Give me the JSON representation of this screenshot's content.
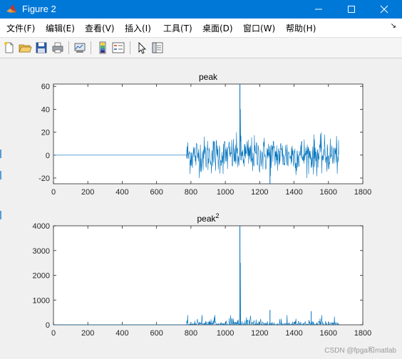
{
  "window": {
    "title": "Figure 2"
  },
  "menu": [
    {
      "label": "文件(F)"
    },
    {
      "label": "编辑(E)"
    },
    {
      "label": "查看(V)"
    },
    {
      "label": "插入(I)"
    },
    {
      "label": "工具(T)"
    },
    {
      "label": "桌面(D)"
    },
    {
      "label": "窗口(W)"
    },
    {
      "label": "帮助(H)"
    }
  ],
  "toolbar": {
    "icons": [
      "new-figure-icon",
      "open-file-icon",
      "save-icon",
      "print-icon",
      "link-plot-icon",
      "insert-colorbar-icon",
      "insert-legend-icon",
      "edit-plot-arrow-icon",
      "property-inspector-icon"
    ]
  },
  "watermark": "CSDN @fpga和matlab",
  "colors": {
    "line": "#0072bd",
    "titlebar": "#0078d7"
  },
  "chart_data": [
    {
      "type": "line",
      "title": "peak",
      "xlabel": "",
      "ylabel": "",
      "xlim": [
        0,
        1800
      ],
      "ylim": [
        -25,
        62
      ],
      "xticks": [
        0,
        200,
        400,
        600,
        800,
        1000,
        1200,
        1400,
        1600,
        1800
      ],
      "yticks": [
        -20,
        0,
        20,
        40,
        60
      ],
      "grid": false,
      "series": [
        {
          "values_description": "zero for x in [0,775], then noisy signal with amplitude about ±20 from 775 to 1660, sharp spike to about 62 and 40 near x=1085, dip to about -25 near x=1260",
          "flat_end": 775,
          "noise_start": 775,
          "noise_end": 1660,
          "noise_amplitude": 20,
          "spikes": [
            [
              1085,
              62
            ],
            [
              1087,
              40
            ],
            [
              1260,
              -25
            ]
          ]
        }
      ]
    },
    {
      "type": "line",
      "title": "peak",
      "title_superscript": "2",
      "xlabel": "",
      "ylabel": "",
      "xlim": [
        0,
        1800
      ],
      "ylim": [
        0,
        4000
      ],
      "xticks": [
        0,
        200,
        400,
        600,
        800,
        1000,
        1200,
        1400,
        1600,
        1800
      ],
      "yticks": [
        0,
        1000,
        2000,
        3000,
        4000
      ],
      "grid": false,
      "series": [
        {
          "values_description": "zero until about 775, then small positive noise up to about 400 through 1660, spike to about 4000 and 2500 near x=1085, spike about 600 near x=1260",
          "flat_end": 775,
          "noise_start": 775,
          "noise_end": 1660,
          "noise_amplitude": 400,
          "spikes": [
            [
              1085,
              4000
            ],
            [
              1087,
              2500
            ],
            [
              1260,
              600
            ],
            [
              1500,
              550
            ]
          ]
        }
      ]
    }
  ]
}
